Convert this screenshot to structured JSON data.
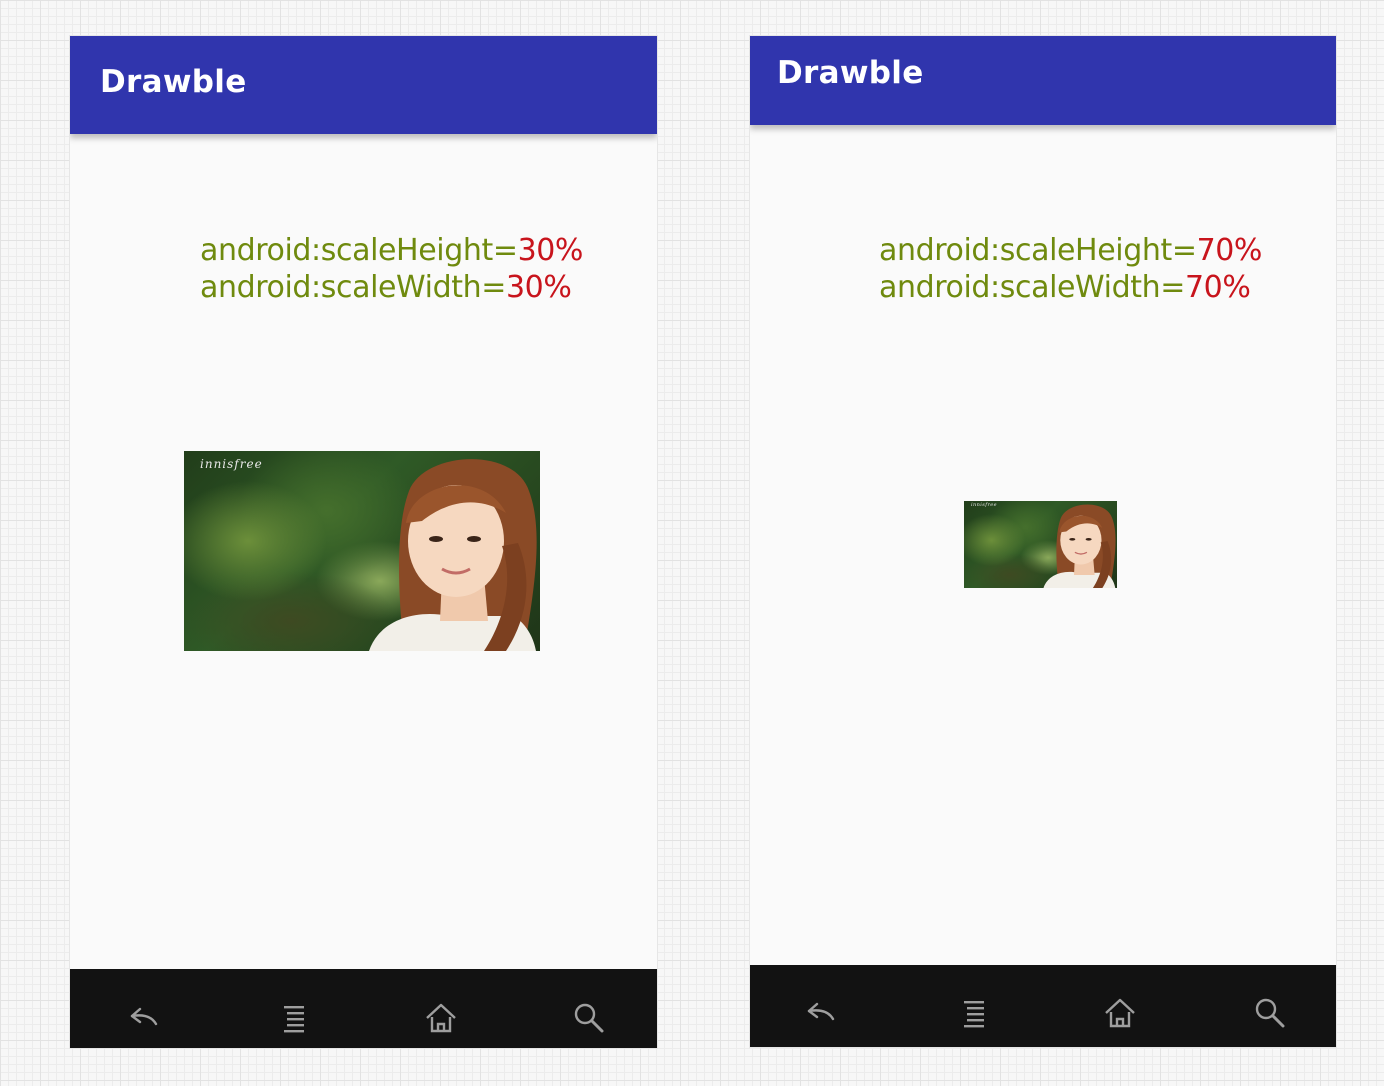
{
  "screens": [
    {
      "app_title": "Drawble",
      "caption": {
        "height_key": "android:scaleHeight=",
        "height_value": "30%",
        "width_key": "android:scaleWidth=",
        "width_value": "30%"
      },
      "image": {
        "brand_text": "innisfree"
      }
    },
    {
      "app_title": "Drawble",
      "caption": {
        "height_key": "android:scaleHeight=",
        "height_value": "70%",
        "width_key": "android:scaleWidth=",
        "width_value": "70%"
      },
      "image": {
        "brand_text": "innisfree"
      }
    }
  ],
  "nav_icons": [
    "back-icon",
    "menu-icon",
    "home-icon",
    "search-icon"
  ],
  "colors": {
    "app_bar": "#3035ad",
    "caption_key": "#6f8a0e",
    "caption_value": "#c8141c",
    "nav_bar": "#121212",
    "screen_background": "#fafafa"
  }
}
